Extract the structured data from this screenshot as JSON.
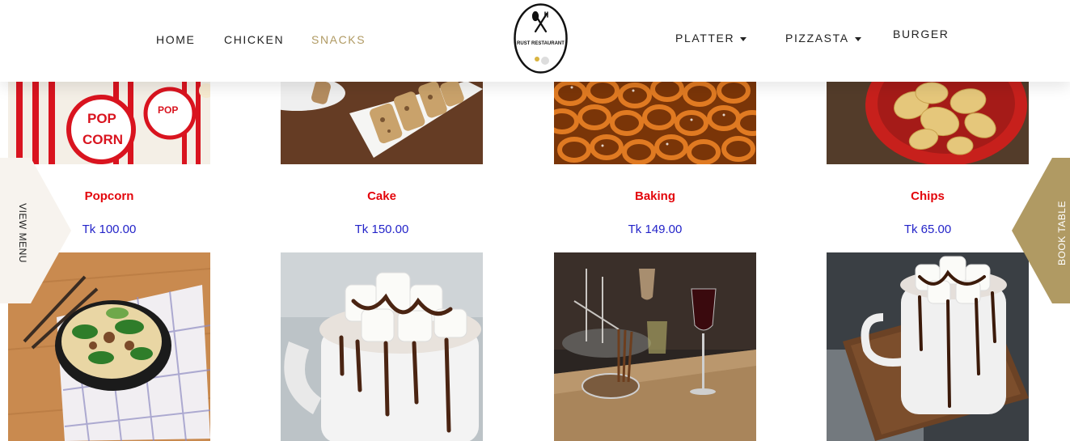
{
  "header": {
    "nav_left": [
      "HOME",
      "CHICKEN",
      "SNACKS"
    ],
    "active": "SNACKS",
    "logo_text": "RUST RESTAURANT",
    "nav_right": [
      {
        "label": "PLATTER",
        "has_dropdown": true
      },
      {
        "label": "PIZZASTA",
        "has_dropdown": true
      },
      {
        "label": "BURGER",
        "has_dropdown": false
      }
    ]
  },
  "side_tabs": {
    "left": "VIEW MENU",
    "right": "BOOK TABLE"
  },
  "products": [
    {
      "name": "Popcorn",
      "price": "Tk 100.00"
    },
    {
      "name": "Cake",
      "price": "Tk 150.00"
    },
    {
      "name": "Baking",
      "price": "Tk 149.00"
    },
    {
      "name": "Chips",
      "price": "Tk 65.00"
    }
  ],
  "colors": {
    "accent": "#b09a63",
    "product_name": "#e3060c",
    "price": "#2424c9",
    "side_left_bg": "#f7f3ee"
  }
}
